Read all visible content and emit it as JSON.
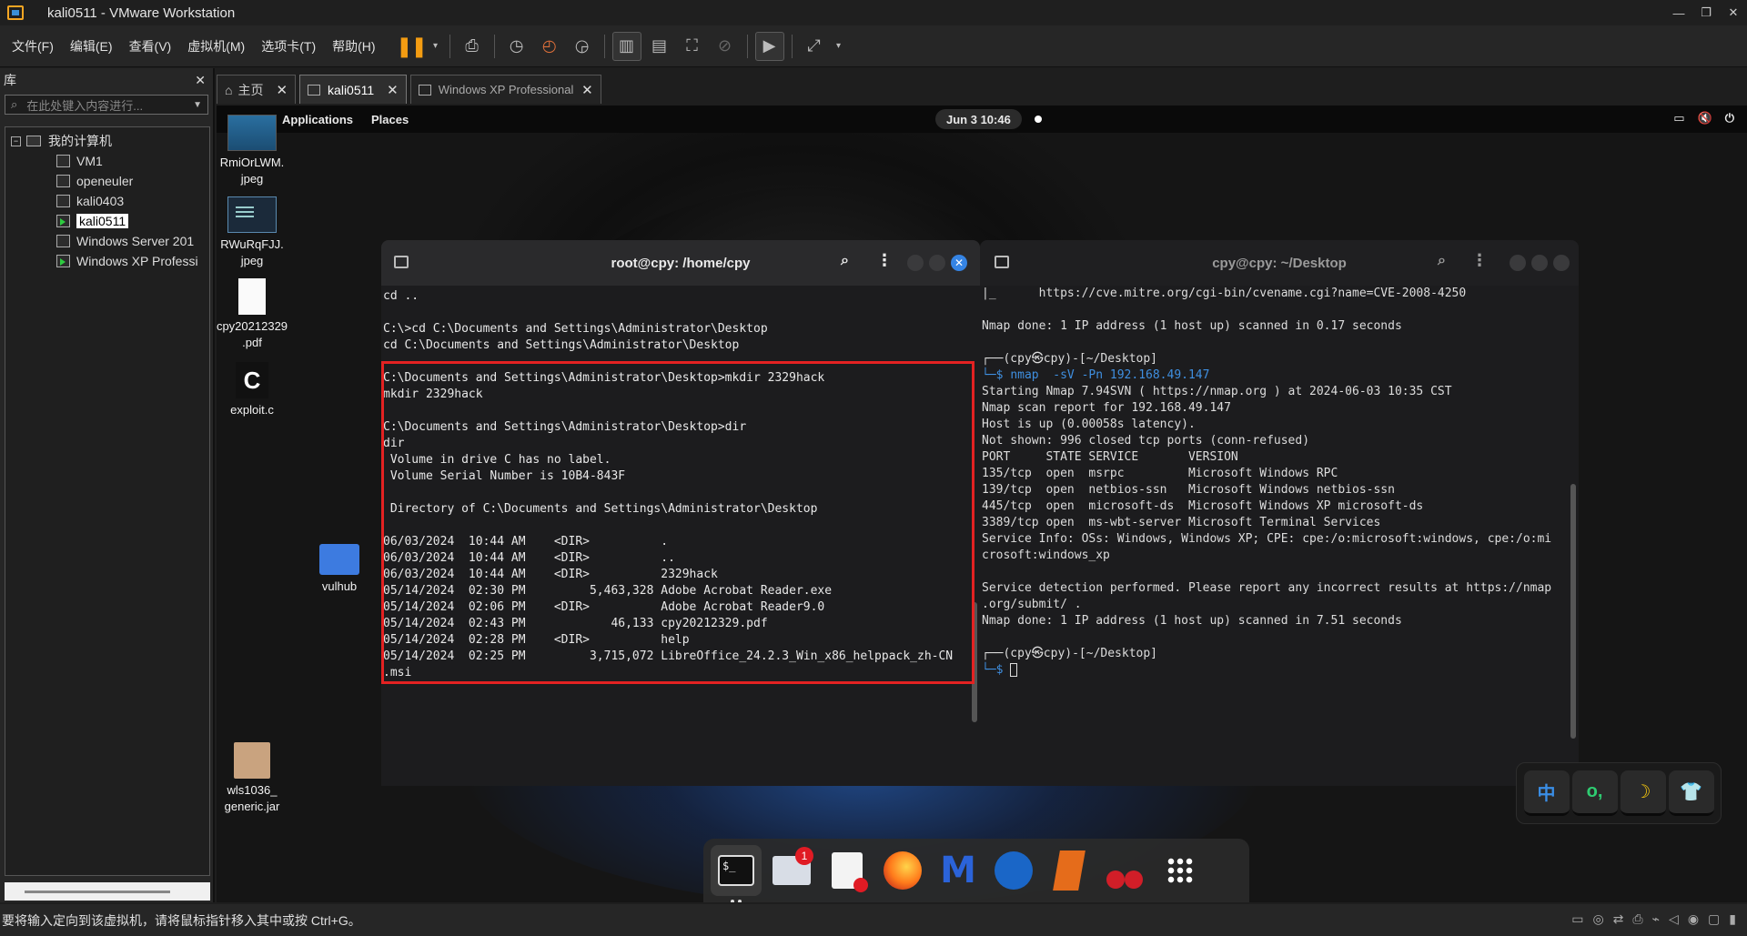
{
  "window": {
    "title": "kali0511 - VMware Workstation",
    "controls": [
      "—",
      "❐",
      "✕"
    ]
  },
  "menubar": {
    "items": [
      "文件(F)",
      "编辑(E)",
      "查看(V)",
      "虚拟机(M)",
      "选项卡(T)",
      "帮助(H)"
    ]
  },
  "library": {
    "title": "库",
    "close": "✕",
    "search_placeholder": "在此处键入内容进行...",
    "root": "我的计算机",
    "vms": [
      {
        "name": "VM1",
        "running": false
      },
      {
        "name": "openeuler",
        "running": false
      },
      {
        "name": "kali0403",
        "running": false
      },
      {
        "name": "kali0511",
        "running": true,
        "selected": true
      },
      {
        "name": "Windows Server 201",
        "running": false
      },
      {
        "name": "Windows XP Professi",
        "running": true
      }
    ]
  },
  "tabs": [
    {
      "label": "主页",
      "active": false
    },
    {
      "label": "kali0511",
      "active": true
    },
    {
      "label": "Windows XP Professional",
      "active": false
    }
  ],
  "guest_topbar": {
    "applications": "Applications",
    "places": "Places",
    "clock": "Jun 3  10:46"
  },
  "desktop_icons": [
    {
      "line1": "RmiOrLWM.",
      "line2": "jpeg"
    },
    {
      "line1": "RWuRqFJJ.",
      "line2": "jpeg"
    },
    {
      "line1": "cpy20212329",
      "line2": ".pdf"
    },
    {
      "line1": "exploit.c",
      "line2": ""
    },
    {
      "line1": "vulhub",
      "line2": ""
    },
    {
      "line1": "wls1036_",
      "line2": "generic.jar"
    }
  ],
  "terminal_root": {
    "title": "root@cpy: /home/cpy",
    "content": "cd ..\n\nC:\\>cd C:\\Documents and Settings\\Administrator\\Desktop\ncd C:\\Documents and Settings\\Administrator\\Desktop\n\nC:\\Documents and Settings\\Administrator\\Desktop>mkdir 2329hack\nmkdir 2329hack\n\nC:\\Documents and Settings\\Administrator\\Desktop>dir\ndir\n Volume in drive C has no label.\n Volume Serial Number is 10B4-843F\n\n Directory of C:\\Documents and Settings\\Administrator\\Desktop\n\n06/03/2024  10:44 AM    <DIR>          .\n06/03/2024  10:44 AM    <DIR>          ..\n06/03/2024  10:44 AM    <DIR>          2329hack\n05/14/2024  02:30 PM         5,463,328 Adobe Acrobat Reader.exe\n05/14/2024  02:06 PM    <DIR>          Adobe Acrobat Reader9.0\n05/14/2024  02:43 PM            46,133 cpy20212329.pdf\n05/14/2024  02:28 PM    <DIR>          help\n05/14/2024  02:25 PM         3,715,072 LibreOffice_24.2.3_Win_x86_helppack_zh-CN\n.msi"
  },
  "terminal_user": {
    "title": "cpy@cpy: ~/Desktop",
    "line_cve": "|_      https://cve.mitre.org/cgi-bin/cvename.cgi?name=CVE-2008-4250",
    "line_done1": "Nmap done: 1 IP address (1 host up) scanned in 0.17 seconds",
    "prompt1": "┌──(cpy㉿cpy)-[~/Desktop]",
    "cmd1_prefix": "└─$ ",
    "cmd1": "nmap  -sV -Pn 192.168.49.147",
    "output": "Starting Nmap 7.94SVN ( https://nmap.org ) at 2024-06-03 10:35 CST\nNmap scan report for 192.168.49.147\nHost is up (0.00058s latency).\nNot shown: 996 closed tcp ports (conn-refused)\nPORT     STATE SERVICE       VERSION\n135/tcp  open  msrpc         Microsoft Windows RPC\n139/tcp  open  netbios-ssn   Microsoft Windows netbios-ssn\n445/tcp  open  microsoft-ds  Microsoft Windows XP microsoft-ds\n3389/tcp open  ms-wbt-server Microsoft Terminal Services\nService Info: OSs: Windows, Windows XP; CPE: cpe:/o:microsoft:windows, cpe:/o:mi\ncrosoft:windows_xp\n\nService detection performed. Please report any incorrect results at https://nmap\n.org/submit/ .\nNmap done: 1 IP address (1 host up) scanned in 7.51 seconds",
    "prompt2": "┌──(cpy㉿cpy)-[~/Desktop]",
    "cmd2_prefix": "└─$ "
  },
  "ime": {
    "keys": [
      "中",
      "o,",
      "☽",
      "👕"
    ]
  },
  "dock": {
    "terminal_glyph": "$_",
    "files_badge": "1"
  },
  "statusbar": {
    "message": "要将输入定向到该虚拟机，请将鼠标指针移入其中或按 Ctrl+G。"
  },
  "colors": {
    "highlight_box": "#e32222",
    "prompt": "#3f8fe0",
    "close_button": "#3584e4"
  }
}
